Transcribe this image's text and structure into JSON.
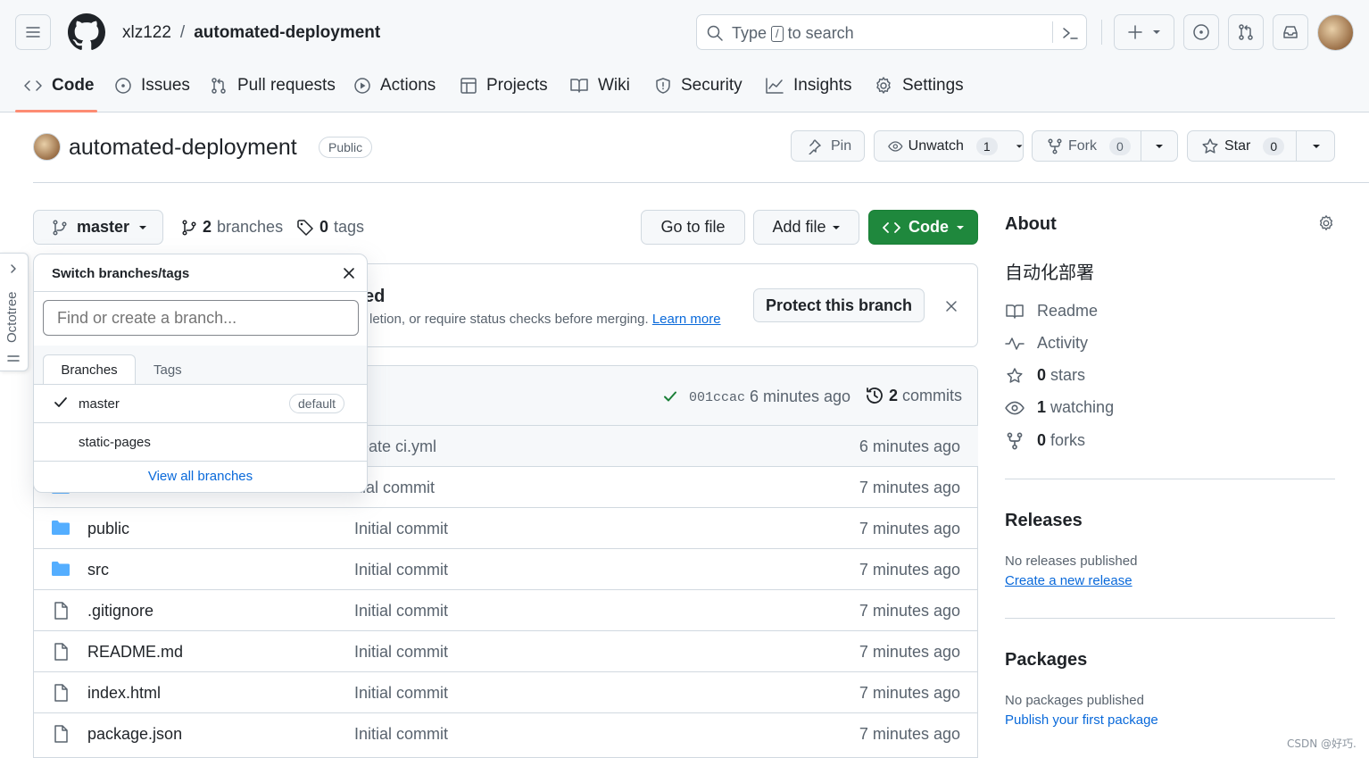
{
  "header": {
    "owner": "xlz122",
    "separator": "/",
    "repo": "automated-deployment",
    "search_prefix": "Type",
    "search_key": "/",
    "search_suffix": "to search"
  },
  "nav": {
    "tabs": [
      "Code",
      "Issues",
      "Pull requests",
      "Actions",
      "Projects",
      "Wiki",
      "Security",
      "Insights",
      "Settings"
    ]
  },
  "repo_header": {
    "name": "automated-deployment",
    "visibility": "Public",
    "pin": "Pin",
    "unwatch": "Unwatch",
    "unwatch_count": "1",
    "fork": "Fork",
    "fork_count": "0",
    "star": "Star",
    "star_count": "0"
  },
  "toolbar": {
    "branch": "master",
    "branches_count": "2",
    "branches_label": "branches",
    "tags_count": "0",
    "tags_label": "tags",
    "go_to_file": "Go to file",
    "add_file": "Add file",
    "code": "Code"
  },
  "protect_banner": {
    "title_fragment": "ed",
    "text_fragment": "letion, or require status checks before merging.",
    "learn_more": "Learn more",
    "protect_button": "Protect this branch"
  },
  "commit_bar": {
    "hash": "001ccac",
    "time": "6 minutes ago",
    "commits_count": "2",
    "commits_label": "commits"
  },
  "files": [
    {
      "name": "",
      "type": "dir",
      "message": "reate ci.yml",
      "time": "6 minutes ago"
    },
    {
      "name": "",
      "type": "dir",
      "message": "itial commit",
      "time": "7 minutes ago"
    },
    {
      "name": "public",
      "type": "dir",
      "message": "Initial commit",
      "time": "7 minutes ago"
    },
    {
      "name": "src",
      "type": "dir",
      "message": "Initial commit",
      "time": "7 minutes ago"
    },
    {
      "name": ".gitignore",
      "type": "file",
      "message": "Initial commit",
      "time": "7 minutes ago"
    },
    {
      "name": "README.md",
      "type": "file",
      "message": "Initial commit",
      "time": "7 minutes ago"
    },
    {
      "name": "index.html",
      "type": "file",
      "message": "Initial commit",
      "time": "7 minutes ago"
    },
    {
      "name": "package.json",
      "type": "file",
      "message": "Initial commit",
      "time": "7 minutes ago"
    }
  ],
  "branch_dropdown": {
    "title": "Switch branches/tags",
    "placeholder": "Find or create a branch...",
    "tab_branches": "Branches",
    "tab_tags": "Tags",
    "branches": [
      "master",
      "static-pages"
    ],
    "default_badge": "default",
    "view_all": "View all branches"
  },
  "octotree": {
    "label": "Octotree"
  },
  "about": {
    "title": "About",
    "description": "自动化部署",
    "readme": "Readme",
    "activity": "Activity",
    "stars_count": "0",
    "stars_label": "stars",
    "watching_count": "1",
    "watching_label": "watching",
    "forks_count": "0",
    "forks_label": "forks"
  },
  "releases": {
    "title": "Releases",
    "empty": "No releases published",
    "link": "Create a new release"
  },
  "packages": {
    "title": "Packages",
    "empty": "No packages published",
    "link": "Publish your first package"
  },
  "watermark": "CSDN @好巧.",
  "colors": {
    "accent_green": "#1f883d",
    "link_blue": "#0969da",
    "tab_underline": "#fd8c73",
    "folder_blue": "#54aeff"
  }
}
